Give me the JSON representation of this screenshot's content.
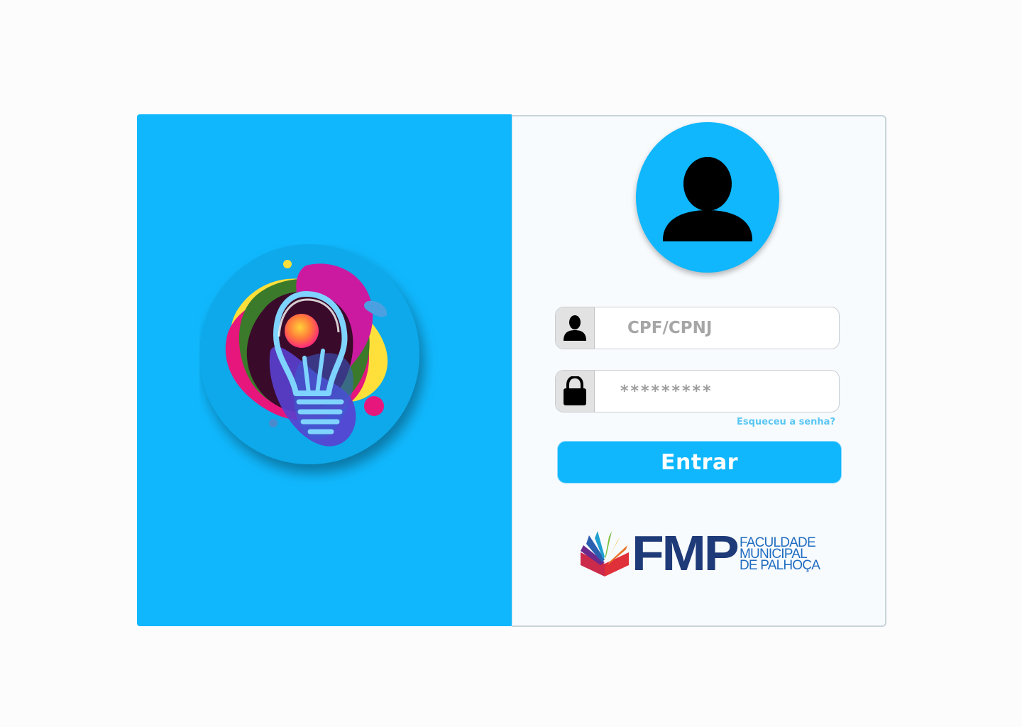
{
  "illustration": {
    "icon": "lightbulb-icon"
  },
  "profile": {
    "avatar_icon": "user-silhouette-icon",
    "accent_color": "#10b7fd"
  },
  "form": {
    "cpf": {
      "icon": "user-icon",
      "placeholder": "CPF/CPNJ",
      "value": ""
    },
    "password": {
      "icon": "lock-icon",
      "masked_value": "*********"
    },
    "forgot_password": "Esqueceu a senha?",
    "submit_label": "Entrar"
  },
  "branding": {
    "acronym": "FMP",
    "name_lines": [
      "FACULDADE",
      "MUNICIPAL",
      "DE PALHOÇA"
    ],
    "primary_color": "#1e3a78",
    "secondary_color": "#1f6cc0"
  },
  "colors": {
    "panel": "#10b7fd",
    "link": "#58c6f3",
    "page": "#fcfcfd"
  }
}
